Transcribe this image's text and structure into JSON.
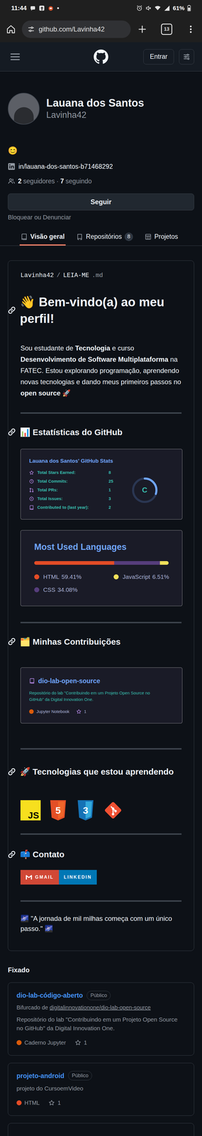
{
  "status_bar": {
    "time": "11:44",
    "battery": "61%"
  },
  "browser": {
    "url": "github.com/Lavinha42",
    "tab_count": "13"
  },
  "header": {
    "sign_in": "Entrar"
  },
  "profile": {
    "name": "Lauana dos Santos",
    "username": "Lavinha42",
    "status_emoji": "😊",
    "linkedin": "in/lauana-dos-santos-b71468292",
    "followers": "2",
    "followers_label": "seguidores",
    "separator": "·",
    "following": "7",
    "following_label": "seguindo",
    "follow_button": "Seguir",
    "block_link": "Bloquear ou Denunciar"
  },
  "tabs": [
    {
      "label": "Visão geral",
      "selected": true
    },
    {
      "label": "Repositórios",
      "count": "8",
      "selected": false
    },
    {
      "label": "Projetos",
      "selected": false
    }
  ],
  "readme": {
    "path": {
      "owner": "Lavinha42",
      "separator": "/",
      "file": "LEIA-ME",
      "ext": ".md"
    },
    "title": "👋 Bem-vindo(a) ao meu perfil!",
    "intro": [
      {
        "text": "Sou estudante de ",
        "bold": false
      },
      {
        "text": "Tecnologia",
        "bold": true
      },
      {
        "text": " e curso ",
        "bold": false
      },
      {
        "text": "Desenvolvimento de Software Multiplataforma",
        "bold": true
      },
      {
        "text": " na FATEC. Estou explorando programação, aprendendo novas tecnologias e dando meus primeiros passos no ",
        "bold": false
      },
      {
        "text": "open source",
        "bold": true
      },
      {
        "text": " 🚀",
        "bold": false
      }
    ],
    "stats_heading": "📊 Estatísticas do GitHub",
    "stats_card": {
      "title": "Lauana dos Santos' GitHub Stats",
      "rows": [
        {
          "label": "Total Stars Earned:",
          "value": "8"
        },
        {
          "label": "Total Commits:",
          "value": "25"
        },
        {
          "label": "Total PRs:",
          "value": "1"
        },
        {
          "label": "Total Issues:",
          "value": "3"
        },
        {
          "label": "Contributed to (last year):",
          "value": "2"
        }
      ],
      "rank": "C",
      "rank_level": 0.3
    },
    "languages_card": {
      "title": "Most Used Languages",
      "languages": [
        {
          "name": "HTML",
          "percent": "59.41%",
          "level": 0.5941,
          "color": "#e34c26"
        },
        {
          "name": "CSS",
          "percent": "34.08%",
          "level": 0.3408,
          "color": "#563d7c"
        },
        {
          "name": "JavaScript",
          "percent": "6.51%",
          "level": 0.0651,
          "color": "#f1e05a"
        }
      ]
    },
    "contributions_heading": "🗂️ Minhas Contribuições",
    "contribution_card": {
      "name": "dio-lab-open-source",
      "description": "Repositório do lab \"Contribuindo em um Projeto Open Source no GitHub\" da Digital Innovation One.",
      "language": "Jupyter Notebook",
      "language_color": "#da5b0b",
      "stars": "1"
    },
    "tech_heading": "🚀 Tecnologias que estou aprendendo",
    "techs": [
      {
        "kind": "js",
        "glyph": "JS"
      },
      {
        "kind": "html",
        "glyph": "5"
      },
      {
        "kind": "css",
        "glyph": "3"
      },
      {
        "kind": "git"
      }
    ],
    "contact_heading": "📫 Contato",
    "badges": [
      {
        "label": "GMAIL",
        "kind": "gmail",
        "color": "#d14836"
      },
      {
        "label": "LINKEDIN",
        "kind": "linkedin",
        "color": "#0077b5"
      }
    ],
    "quote": "🌌 \"A jornada de mil milhas começa com um único passo.\" 🌌"
  },
  "pinned_title": "Fixado",
  "pinned": [
    {
      "name": "dio-lab-código-aberto",
      "visibility": "Público",
      "fork_prefix": "Bifurcado de ",
      "fork_source": "digitalinnovationone/dio-lab-open-source",
      "description": "Repositório do lab \"Contribuindo em um Projeto Open Source no GitHub\" da Digital Innovation One.",
      "language": "Caderno Jupyter",
      "language_color": "#da5b0b",
      "stars": "1"
    },
    {
      "name": "projeto-android",
      "visibility": "Público",
      "description": "projeto do CursoemVideo",
      "language": "HTML",
      "language_color": "#e34c26",
      "stars": "1"
    }
  ]
}
